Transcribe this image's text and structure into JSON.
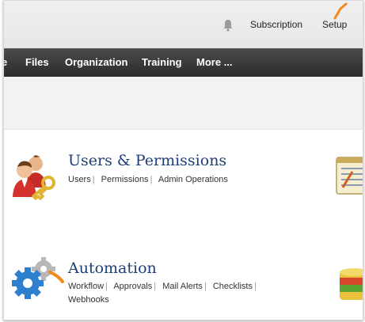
{
  "topbar": {
    "subscription_label": "Subscription",
    "setup_label": "Setup"
  },
  "nav": {
    "items": [
      {
        "label": "e"
      },
      {
        "label": "Files"
      },
      {
        "label": "Organization"
      },
      {
        "label": "Training"
      },
      {
        "label": "More ..."
      }
    ]
  },
  "sections": [
    {
      "title": "Users & Permissions",
      "links": [
        "Users",
        "Permissions",
        "Admin Operations"
      ],
      "separator": "|"
    },
    {
      "title": "Automation",
      "links": [
        "Workflow",
        "Approvals",
        "Mail Alerts",
        "Checklists",
        "Webhooks"
      ],
      "separator": "|"
    }
  ],
  "colors": {
    "nav_bg": "#333333",
    "title": "#1f3f74",
    "highlight_marker": "#f08a1c"
  },
  "icons": {
    "bell": "bell-icon",
    "users": "users-keys-icon",
    "automation": "gears-icon",
    "notepad": "notepad-icon",
    "database": "database-icon"
  }
}
